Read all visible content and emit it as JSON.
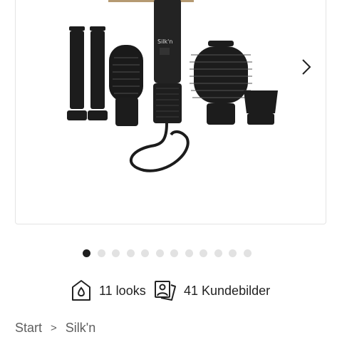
{
  "gallery": {
    "dot_count": 12,
    "active_index": 0,
    "colors": {
      "dot_active": "#1f1f1f",
      "dot_inactive": "#e2e2e2",
      "product": "#1c1c1c"
    }
  },
  "info": {
    "looks_label": "11 looks",
    "customer_images_label": "41 Kundebilder",
    "looks_icon": "house-drop-icon",
    "customer_images_icon": "photo-stack-icon"
  },
  "breadcrumb": {
    "items": [
      "Start",
      "Silk'n"
    ],
    "separator": ">"
  },
  "product": {
    "brand_mark": "Silk'n"
  }
}
